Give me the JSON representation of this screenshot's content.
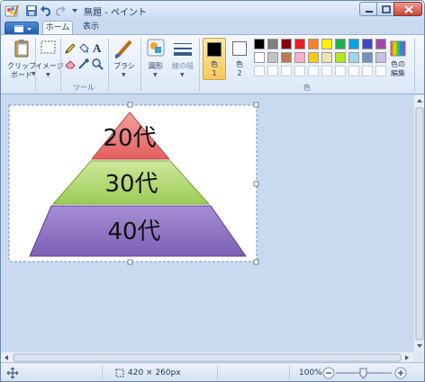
{
  "window": {
    "title": "無題 - ペイント"
  },
  "ribbon": {
    "tabs": [
      "ホーム",
      "表示"
    ],
    "clipboard_label": "クリップ\nボード",
    "image_label": "イメージ",
    "tools_group_label": "ツール",
    "brush_label": "ブラシ",
    "shapes_label": "図形",
    "line_width_label": "線の幅",
    "color1_label": "色\n1",
    "color2_label": "色\n2",
    "colors_group_label": "色",
    "edit_colors_label": "色の\n編集",
    "palette_row1": [
      "#000000",
      "#7f7f7f",
      "#880015",
      "#ed1c24",
      "#ff7f27",
      "#fff200",
      "#22b14c",
      "#00a2e8",
      "#3f48cc",
      "#a349a4"
    ],
    "palette_row2": [
      "#ffffff",
      "#c3c3c3",
      "#b97a57",
      "#ffaec9",
      "#ffc90e",
      "#efe4b0",
      "#b5e61d",
      "#99d9ea",
      "#7092be",
      "#c8bfe7"
    ],
    "color1": "#000000",
    "color2": "#ffffff"
  },
  "canvas": {
    "pyramid": [
      "20代",
      "30代",
      "40代"
    ]
  },
  "status": {
    "size": "420 × 260px",
    "zoom": "100%"
  }
}
